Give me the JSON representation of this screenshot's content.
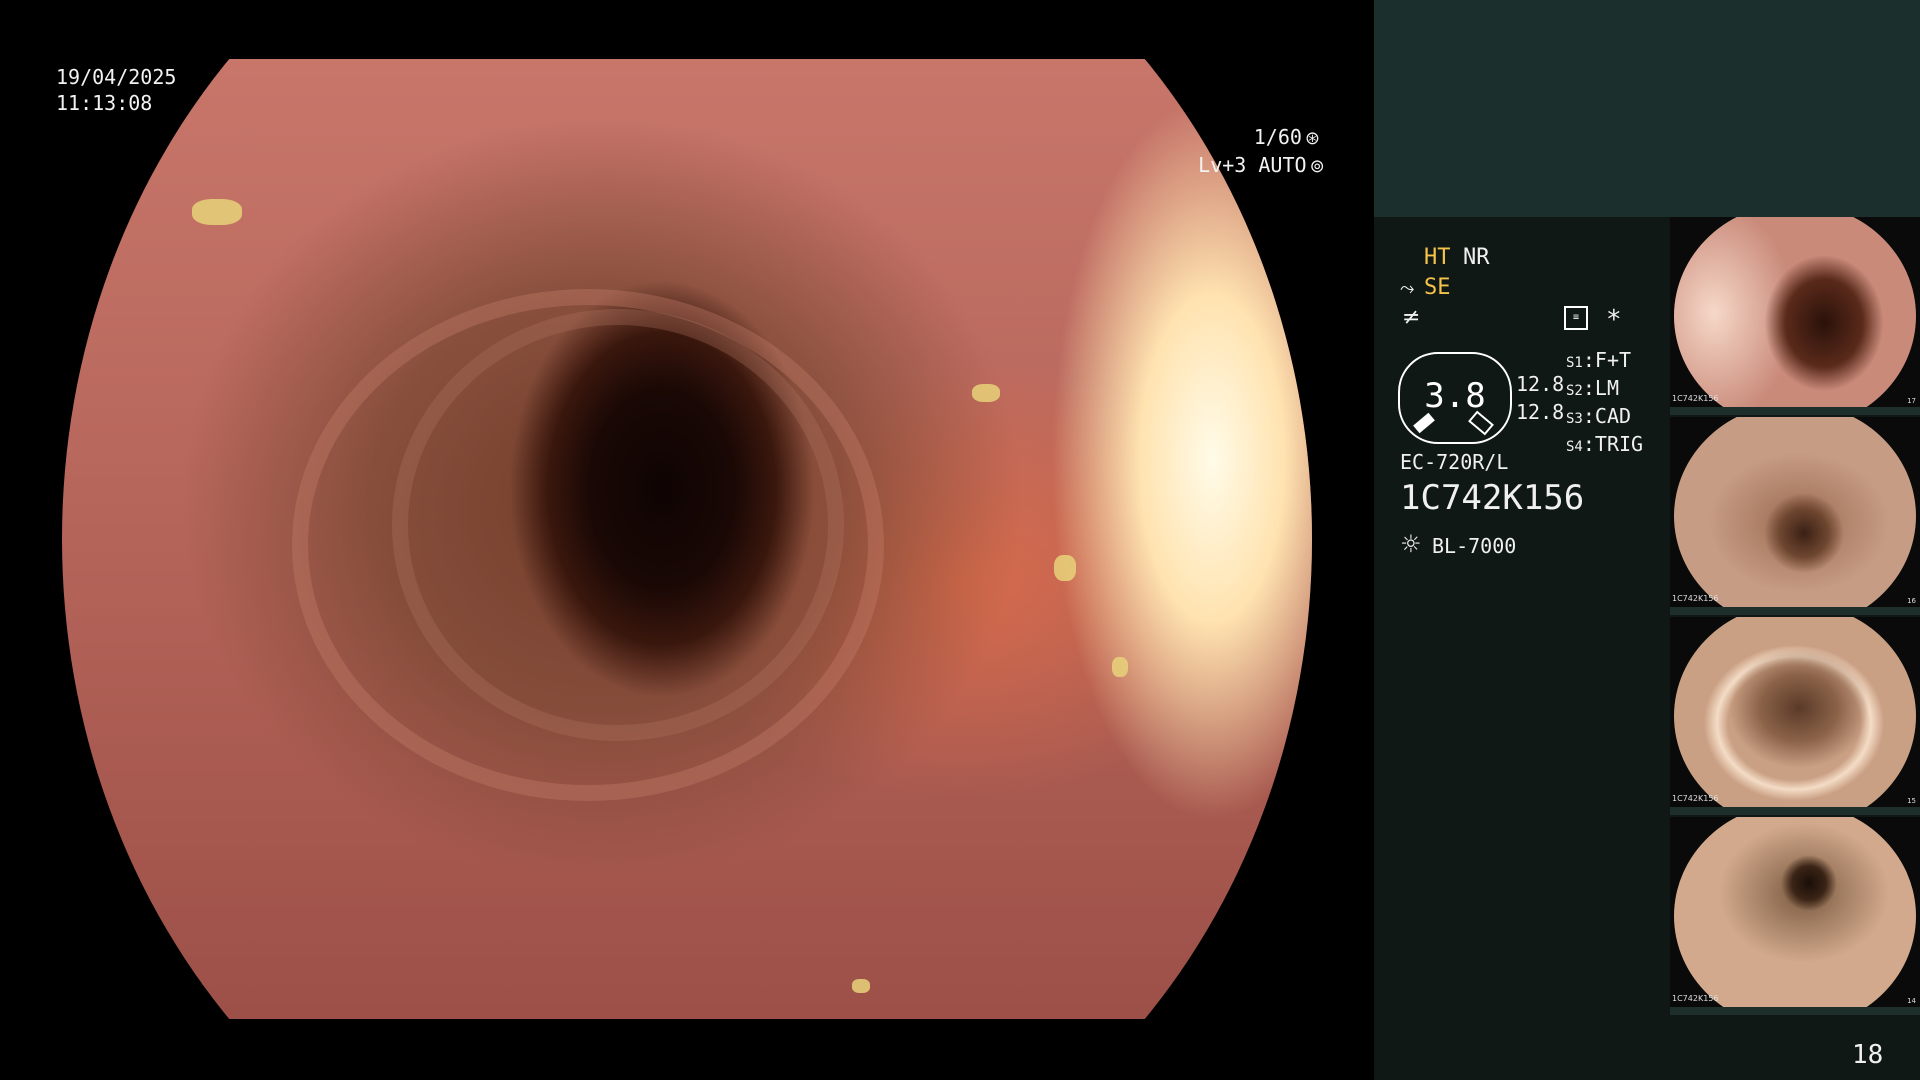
{
  "osd": {
    "date": "19/04/2025",
    "time": "11:13:08",
    "shutter": "1/60",
    "shutter_icon": "aperture-icon",
    "level": "Lv+3",
    "auto_label": "AUTO",
    "auto_icon": "iris-icon"
  },
  "status": {
    "ht": "HT",
    "nr": "NR",
    "se": "SE",
    "se_icon": "signal-icon",
    "f_icon": "filter-icon",
    "record_icon": "record-icon",
    "star": "*",
    "zoom_value": "3.8",
    "left_vals": [
      "12.8",
      "12.8"
    ],
    "switches": [
      {
        "key": "S1",
        "value": "F+T"
      },
      {
        "key": "S2",
        "value": "LM"
      },
      {
        "key": "S3",
        "value": "CAD"
      },
      {
        "key": "S4",
        "value": "TRIG"
      }
    ],
    "scope_model": "EC-720R/L",
    "serial": "1C742K156",
    "light_source": "BL-7000",
    "light_icon": "sun-icon"
  },
  "thumbnails": [
    {
      "caption": "1C742K156",
      "num": "17"
    },
    {
      "caption": "1C742K156",
      "num": "16"
    },
    {
      "caption": "1C742K156",
      "num": "15"
    },
    {
      "caption": "1C742K156",
      "num": "14"
    }
  ],
  "page_number": "18",
  "colors": {
    "panel_bg": "#101815",
    "panel_header": "#1b2f2c",
    "accent_yellow": "#f5c24a"
  }
}
